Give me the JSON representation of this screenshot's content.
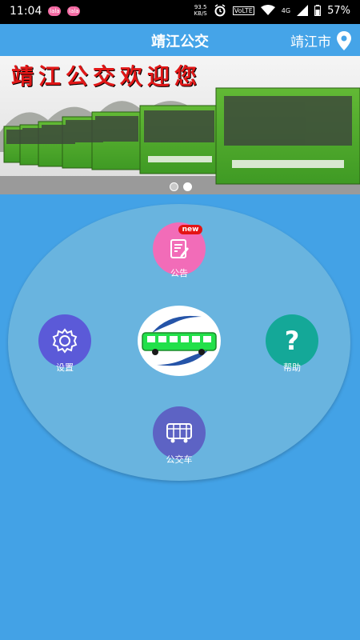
{
  "status_bar": {
    "time": "11:04",
    "net_speed_value": "93.5",
    "net_speed_unit": "KB/S",
    "volte": "VoLTE",
    "network": "4G",
    "battery": "57%"
  },
  "header": {
    "title": "靖江公交",
    "city": "靖江市"
  },
  "banner": {
    "text": "靖江公交欢迎您",
    "slide_count": 2,
    "active_slide": 2
  },
  "menu": {
    "announcement": {
      "label": "公告",
      "badge": "new",
      "icon": "edit-document-icon"
    },
    "settings": {
      "label": "设置",
      "icon": "gear-icon"
    },
    "help": {
      "label": "帮助",
      "icon": "question-icon"
    },
    "bus": {
      "label": "公交车",
      "icon": "bus-icon"
    }
  },
  "colors": {
    "background": "#43a2e6",
    "ellipse": "#69b4df",
    "announcement": "#f26cb8",
    "settings": "#5b5ad8",
    "help": "#14a898",
    "bus": "#5d63c4",
    "badge": "#e41414"
  }
}
